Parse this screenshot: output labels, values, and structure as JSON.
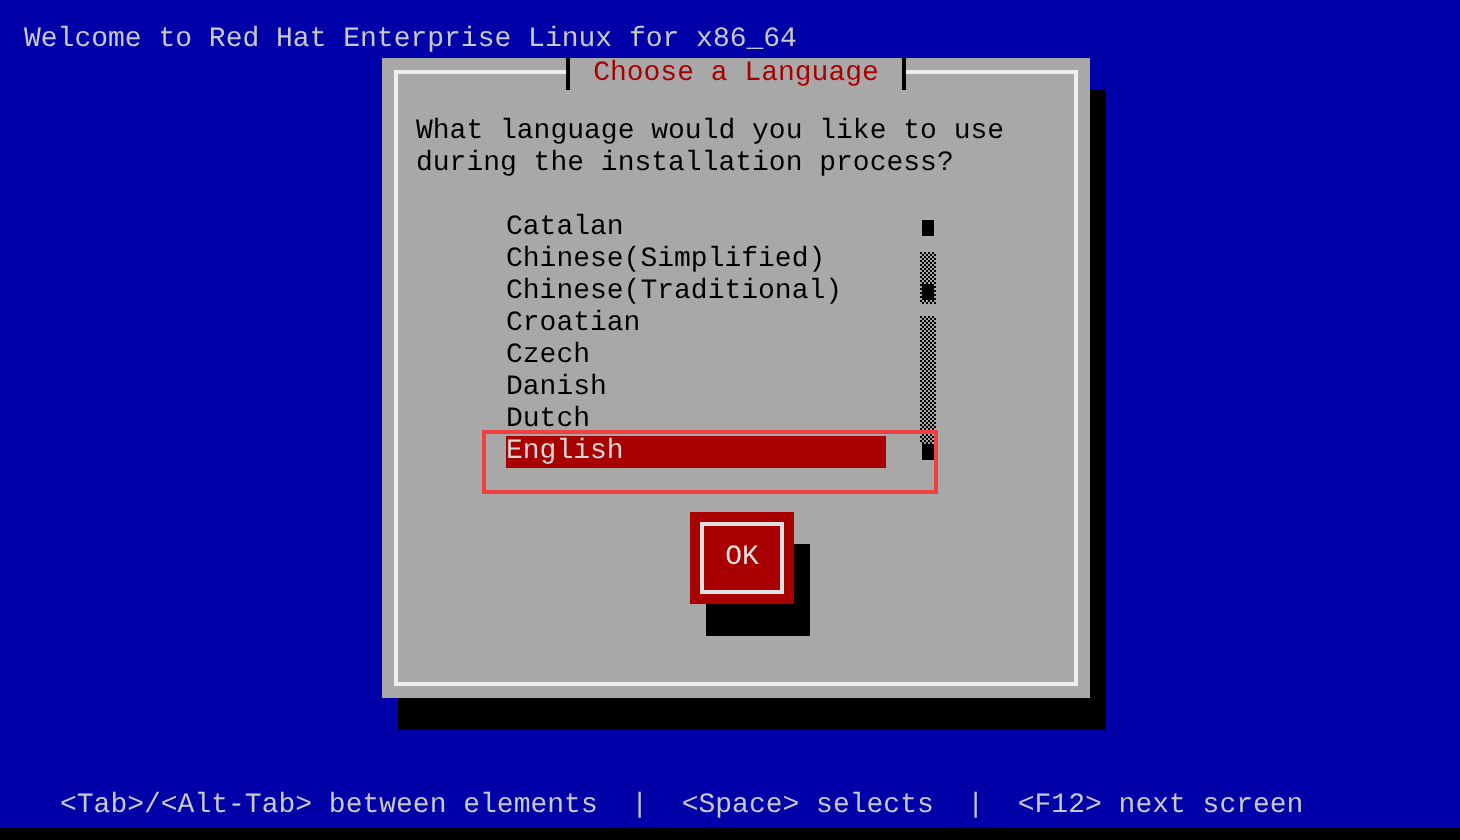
{
  "header": {
    "title": "Welcome to Red Hat Enterprise Linux for x86_64"
  },
  "dialog": {
    "title": "Choose a Language",
    "prompt": "What language would you like to use during the installation process?",
    "languages": [
      {
        "label": "Catalan",
        "selected": false
      },
      {
        "label": "Chinese(Simplified)",
        "selected": false
      },
      {
        "label": "Chinese(Traditional)",
        "selected": false
      },
      {
        "label": "Croatian",
        "selected": false
      },
      {
        "label": "Czech",
        "selected": false
      },
      {
        "label": "Danish",
        "selected": false
      },
      {
        "label": "Dutch",
        "selected": false
      },
      {
        "label": "English",
        "selected": true
      }
    ],
    "buttons": [
      {
        "label": "OK",
        "focused": true
      }
    ]
  },
  "status_bar": {
    "hint": "<Tab>/<Alt-Tab> between elements  |  <Space> selects  |  <F12> next screen"
  }
}
